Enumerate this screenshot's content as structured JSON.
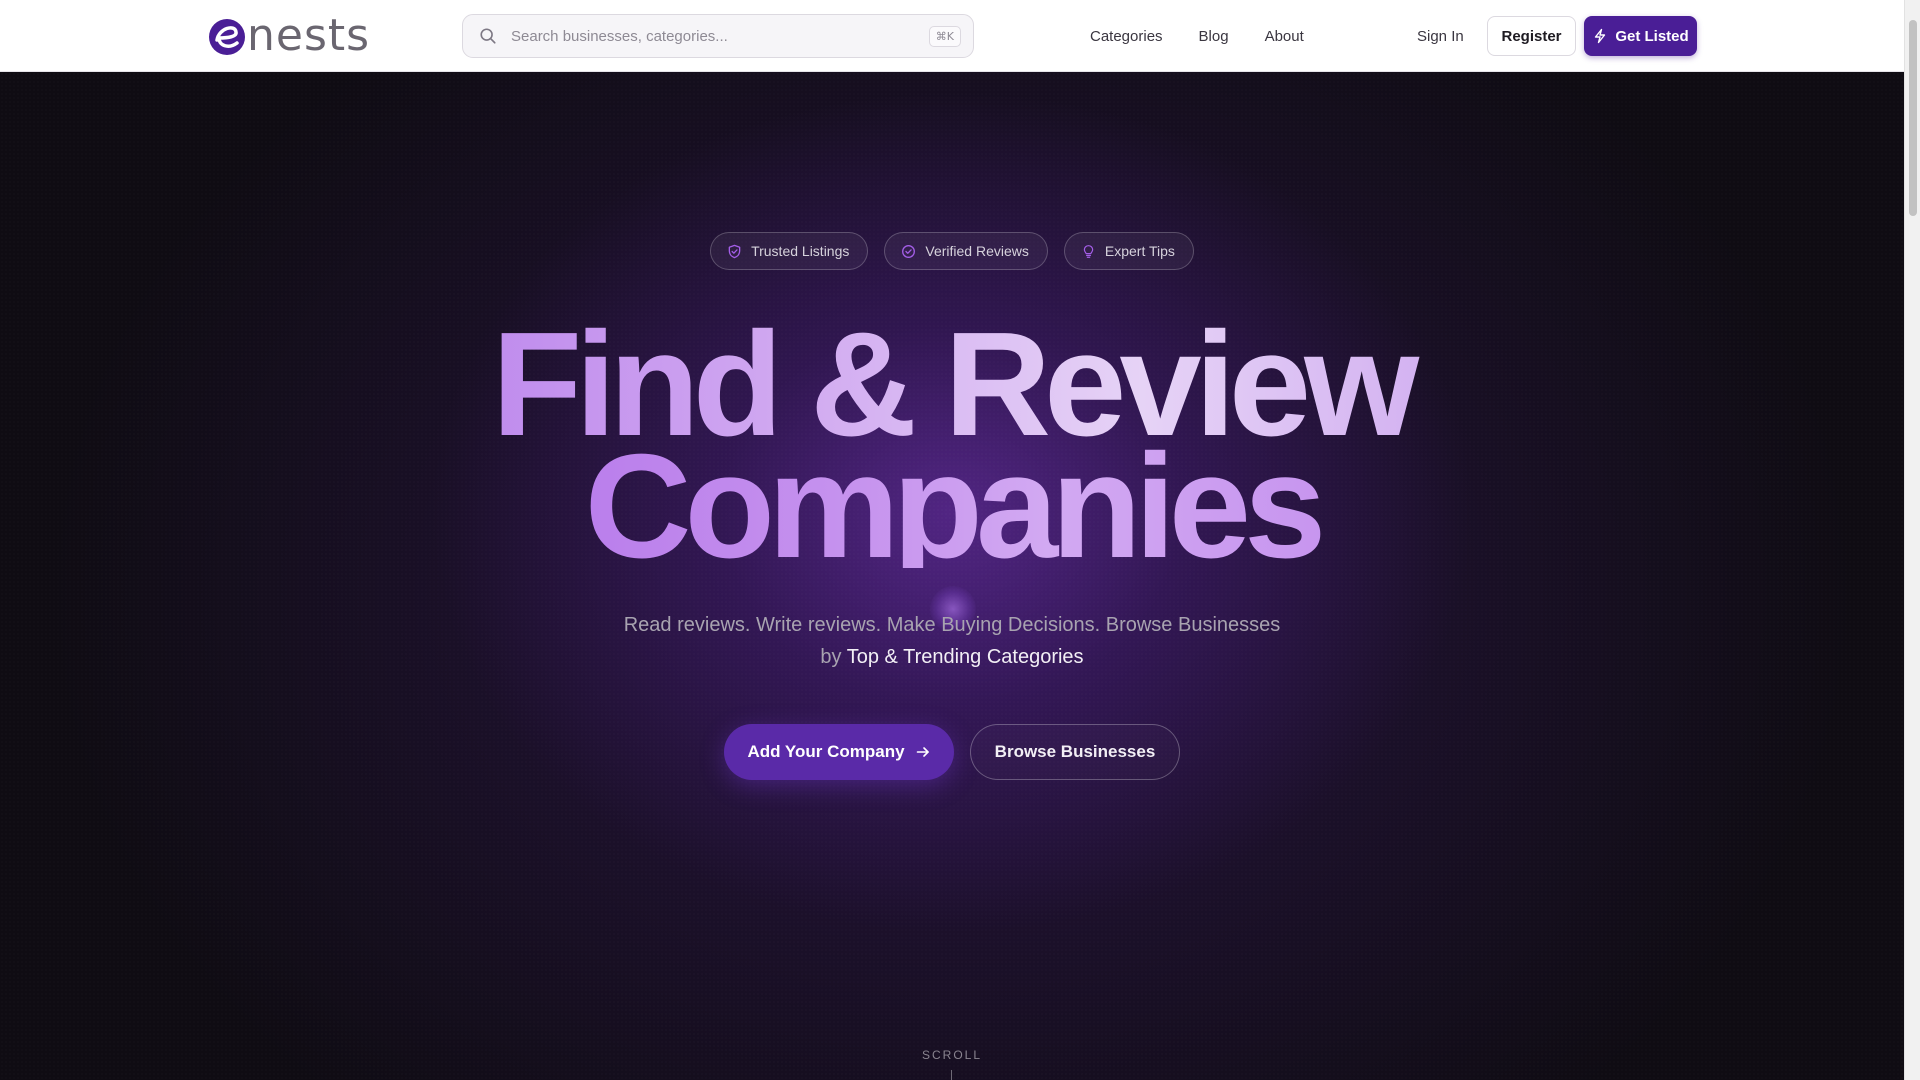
{
  "header": {
    "logo_text": "nests",
    "search": {
      "placeholder": "Search businesses, categories...",
      "shortcut": "⌘K"
    },
    "nav": [
      "Categories",
      "Blog",
      "About"
    ],
    "signin_label": "Sign In",
    "register_label": "Register",
    "get_listed_label": "Get Listed"
  },
  "hero": {
    "badges": [
      {
        "label": "Trusted Listings",
        "icon": "shield-check-icon"
      },
      {
        "label": "Verified Reviews",
        "icon": "circle-check-icon"
      },
      {
        "label": "Expert Tips",
        "icon": "lightbulb-icon"
      }
    ],
    "headline_line1": "Find & Review",
    "headline_line2": "Companies",
    "subtitle_part1": "Read reviews. Write reviews. Make Buying Decisions. Browse Businesses",
    "subtitle_part2": "by ",
    "subtitle_highlight": "Top & Trending Categories",
    "add_company_label": "Add Your Company",
    "browse_label": "Browse Businesses",
    "scroll_label": "SCROLL"
  },
  "colors": {
    "brand": "#4a1e96",
    "accent_purple": "#a45ee8",
    "hero_background": "#0f0c13"
  }
}
